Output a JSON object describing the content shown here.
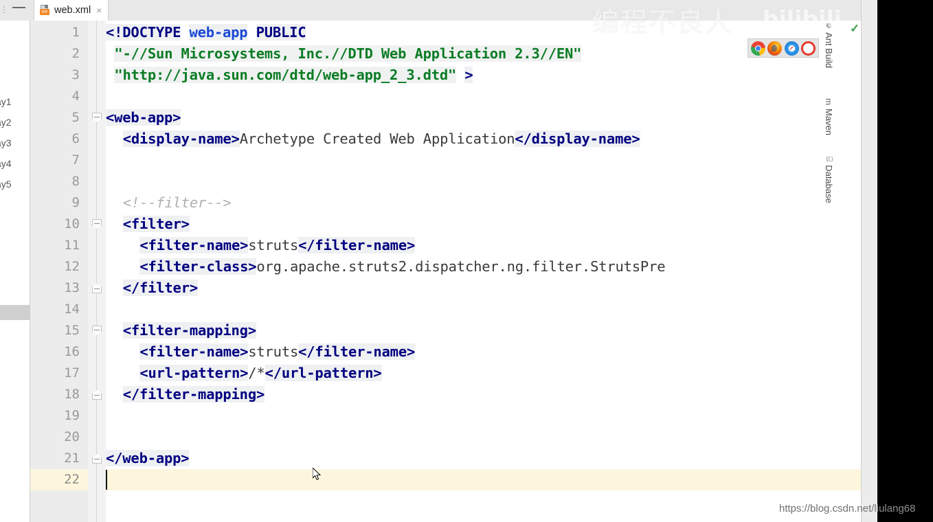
{
  "window": {
    "minimize_label": "—",
    "edge_label": "⋮"
  },
  "tab": {
    "filename": "web.xml",
    "icon": "xml-file-icon",
    "icon_chip_text": "<>",
    "close_label": "×"
  },
  "sidebar_left": {
    "items": [
      {
        "label": "ay1"
      },
      {
        "label": "ay2"
      },
      {
        "label": "ay3"
      },
      {
        "label": "ay4"
      },
      {
        "label": "ay5"
      }
    ]
  },
  "sidebar_right": {
    "tabs": [
      {
        "label": "Ant Build",
        "icon": "ant-icon",
        "glyph": "✵"
      },
      {
        "label": "Maven",
        "icon": "maven-icon",
        "glyph": "m"
      },
      {
        "label": "Database",
        "icon": "database-icon",
        "glyph": "⌸"
      }
    ]
  },
  "editor": {
    "language": "xml",
    "current_line": 22,
    "total_lines": 22,
    "caret_column": 1,
    "inspection_status": "✓",
    "line_numbers": [
      1,
      2,
      3,
      4,
      5,
      6,
      7,
      8,
      9,
      10,
      11,
      12,
      13,
      14,
      15,
      16,
      17,
      18,
      19,
      20,
      21,
      22
    ],
    "fold_markers": [
      {
        "line": 5,
        "type": "open"
      },
      {
        "line": 10,
        "type": "open"
      },
      {
        "line": 13,
        "type": "end"
      },
      {
        "line": 15,
        "type": "open"
      },
      {
        "line": 18,
        "type": "end"
      },
      {
        "line": 21,
        "type": "end"
      }
    ],
    "lines": [
      {
        "n": 1,
        "indent": 0,
        "tokens": [
          {
            "t": "kw",
            "v": "<!DOCTYPE"
          },
          {
            "t": "txt",
            "v": " "
          },
          {
            "t": "tagname",
            "v": "web-app"
          },
          {
            "t": "txt",
            "v": " "
          },
          {
            "t": "kw",
            "v": "PUBLIC"
          }
        ]
      },
      {
        "n": 2,
        "indent": 1,
        "tokens": [
          {
            "t": "str",
            "v": "\"-//Sun Microsystems, Inc.//DTD Web Application 2.3//EN\""
          }
        ]
      },
      {
        "n": 3,
        "indent": 1,
        "tokens": [
          {
            "t": "str",
            "v": "\"http://java.sun.com/dtd/web-app_2_3.dtd\""
          },
          {
            "t": "txt",
            "v": " "
          },
          {
            "t": "kw",
            "v": ">"
          }
        ]
      },
      {
        "n": 4,
        "indent": 0,
        "tokens": []
      },
      {
        "n": 5,
        "indent": 0,
        "tokens": [
          {
            "t": "tag",
            "v": "<web-app>"
          }
        ]
      },
      {
        "n": 6,
        "indent": 2,
        "tokens": [
          {
            "t": "tag",
            "v": "<display-name>"
          },
          {
            "t": "txt",
            "v": "Archetype Created Web Application"
          },
          {
            "t": "tag",
            "v": "</display-name>"
          }
        ]
      },
      {
        "n": 7,
        "indent": 0,
        "tokens": []
      },
      {
        "n": 8,
        "indent": 0,
        "tokens": []
      },
      {
        "n": 9,
        "indent": 2,
        "tokens": [
          {
            "t": "cmt",
            "v": "<!--filter-->"
          }
        ]
      },
      {
        "n": 10,
        "indent": 2,
        "tokens": [
          {
            "t": "tag",
            "v": "<filter>"
          }
        ]
      },
      {
        "n": 11,
        "indent": 4,
        "tokens": [
          {
            "t": "tag",
            "v": "<filter-name>"
          },
          {
            "t": "txt",
            "v": "struts"
          },
          {
            "t": "tag",
            "v": "</filter-name>"
          }
        ]
      },
      {
        "n": 12,
        "indent": 4,
        "tokens": [
          {
            "t": "tag",
            "v": "<filter-class>"
          },
          {
            "t": "txt",
            "v": "org.apache.struts2.dispatcher.ng.filter.StrutsPre"
          }
        ]
      },
      {
        "n": 13,
        "indent": 2,
        "tokens": [
          {
            "t": "tag",
            "v": "</filter>"
          }
        ]
      },
      {
        "n": 14,
        "indent": 0,
        "tokens": []
      },
      {
        "n": 15,
        "indent": 2,
        "tokens": [
          {
            "t": "tag",
            "v": "<filter-mapping>"
          }
        ]
      },
      {
        "n": 16,
        "indent": 4,
        "tokens": [
          {
            "t": "tag",
            "v": "<filter-name>"
          },
          {
            "t": "txt",
            "v": "struts"
          },
          {
            "t": "tag",
            "v": "</filter-name>"
          }
        ]
      },
      {
        "n": 17,
        "indent": 4,
        "tokens": [
          {
            "t": "tag",
            "v": "<url-pattern>"
          },
          {
            "t": "txt",
            "v": "/*"
          },
          {
            "t": "tag",
            "v": "</url-pattern>"
          }
        ]
      },
      {
        "n": 18,
        "indent": 2,
        "tokens": [
          {
            "t": "tag",
            "v": "</filter-mapping>"
          }
        ]
      },
      {
        "n": 19,
        "indent": 0,
        "tokens": []
      },
      {
        "n": 20,
        "indent": 0,
        "tokens": []
      },
      {
        "n": 21,
        "indent": 0,
        "tokens": [
          {
            "t": "tag",
            "v": "</web-app>"
          }
        ]
      },
      {
        "n": 22,
        "indent": 0,
        "tokens": []
      }
    ]
  },
  "browser_popup": {
    "browsers": [
      {
        "name": "chrome-icon"
      },
      {
        "name": "firefox-icon"
      },
      {
        "name": "safari-icon"
      },
      {
        "name": "opera-icon"
      }
    ]
  },
  "watermarks": {
    "top_text": "编程不良人",
    "top_logo": "bilibili",
    "bottom_text": "https://blog.csdn.net/liulang68"
  },
  "colors": {
    "tag": "#000080",
    "tagname": "#1a48d6",
    "string": "#0b7c24",
    "comment": "#b0b0b0",
    "current_line": "#fdf6dd",
    "gutter": "#ececec",
    "chrome_accent": "#4285f4"
  }
}
